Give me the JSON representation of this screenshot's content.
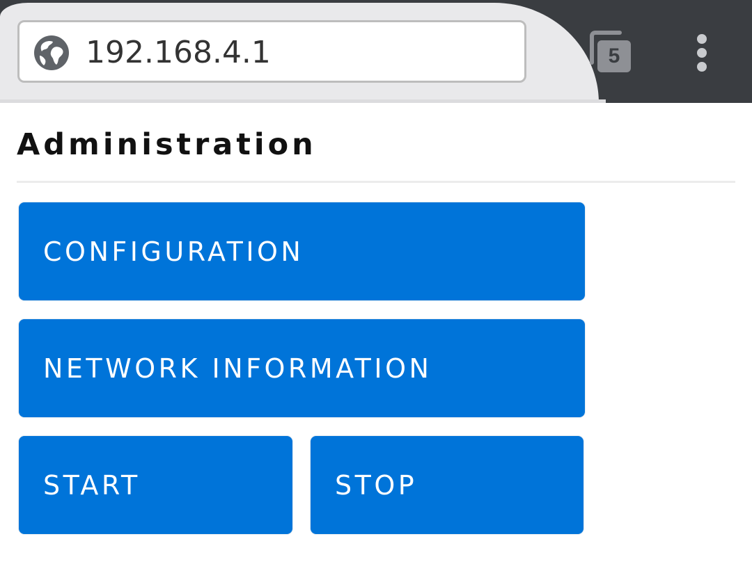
{
  "browser": {
    "url": "192.168.4.1",
    "tab_count": "5",
    "icons": {
      "site_info": "globe-icon",
      "tabs": "tabs-icon",
      "menu": "more-vertical-icon"
    },
    "colors": {
      "toolbar_dark": "#3a3d41",
      "toolbar_light": "#e9e9eb"
    }
  },
  "page": {
    "title": "Administration",
    "buttons": {
      "configuration": "CONFIGURATION",
      "network_information": "NETWORK INFORMATION",
      "start": "START",
      "stop": "STOP"
    },
    "colors": {
      "button_bg": "#0074d9",
      "button_text": "#ffffff"
    }
  }
}
